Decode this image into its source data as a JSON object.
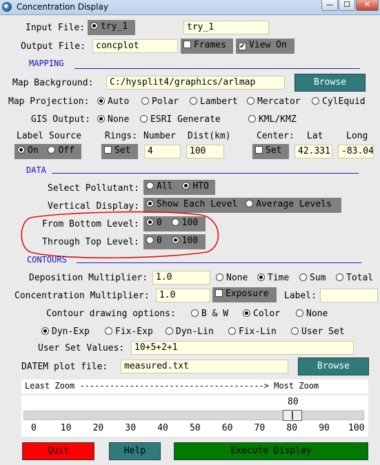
{
  "window": {
    "title": "Concentration Display",
    "btn_min": "—",
    "btn_max": "☐",
    "btn_close": "✕"
  },
  "input_file": {
    "label": "Input File:",
    "selected": "try_1",
    "value": "try_1"
  },
  "output_file": {
    "label": "Output File:",
    "value": "concplot",
    "frames_label": "Frames",
    "frames_checked": false,
    "viewon_label": "View On",
    "viewon_checked": true
  },
  "mapping": {
    "section_label": "MAPPING",
    "map_bg_label": "Map Background:",
    "map_bg_value": "C:/hysplit4/graphics/arlmap",
    "browse_label": "Browse",
    "projection_label": "Map Projection:",
    "projections": [
      "Auto",
      "Polar",
      "Lambert",
      "Mercator",
      "CylEquid"
    ],
    "projection_selected": "Auto",
    "gis_label": "GIS Output:",
    "gis_options": [
      "None",
      "ESRI Generate",
      "KML/KMZ"
    ],
    "gis_selected": "None",
    "label_source": "Label Source",
    "rings": "Rings:",
    "number": "Number",
    "dist": "Dist(km)",
    "center": "Center:",
    "lat": "Lat",
    "long": "Long",
    "ls_on": "On",
    "ls_off": "Off",
    "set_label": "Set",
    "rings_number_value": "4",
    "rings_dist_value": "100",
    "center_set_label": "Set",
    "lat_value": "42.331",
    "long_value": "-83.04"
  },
  "data": {
    "section_label": "DATA",
    "pollutant_label": "Select Pollutant:",
    "pollutant_all": "All",
    "pollutant_hto": "HTO",
    "pollutant_selected": "HTO",
    "vertical_label": "Vertical Display:",
    "vertical_each": "Show Each Level",
    "vertical_avg": "Average Levels",
    "vertical_selected": "Show Each Level",
    "bottom_label": "From Bottom Level:",
    "through_label": "Through Top Level:",
    "level_0": "0",
    "level_100": "100",
    "bottom_selected": "0",
    "top_selected": "100"
  },
  "contours": {
    "section_label": "CONTOURS",
    "dep_mult_label": "Deposition Multiplier:",
    "dep_mult_value": "1.0",
    "dep_options": [
      "None",
      "Time",
      "Sum",
      "Total"
    ],
    "dep_selected": "Time",
    "conc_mult_label": "Concentration Multiplier:",
    "conc_mult_value": "1.0",
    "exposure_label": "Exposure",
    "label_label": "Label:",
    "label_value": "",
    "drawing_label": "Contour drawing options:",
    "drawing_options": [
      "B & W",
      "Color",
      "None"
    ],
    "drawing_selected": "Color",
    "type_options": [
      "Dyn-Exp",
      "Fix-Exp",
      "Dyn-Lin",
      "Fix-Lin",
      "User Set"
    ],
    "type_selected": "Dyn-Exp",
    "user_values_label": "User Set Values:",
    "user_values_value": "10+5+2+1",
    "datem_label": "DATEM plot file:",
    "datem_value": "measured.txt",
    "browse_label": "Browse"
  },
  "zoom": {
    "caption": "Least Zoom -------------------------------------> Most Zoom",
    "value_text": "80",
    "value": 80,
    "ticks": [
      "0",
      "10",
      "20",
      "30",
      "40",
      "50",
      "60",
      "70",
      "80",
      "90",
      "100"
    ]
  },
  "footer": {
    "quit": "Quit",
    "help": "Help",
    "execute": "Execute Display"
  },
  "colors": {
    "annotation": "#e01010",
    "quit": "#ff0000",
    "execute": "#007a00",
    "teal": "#2f7a7a",
    "section": "#1010c0"
  }
}
